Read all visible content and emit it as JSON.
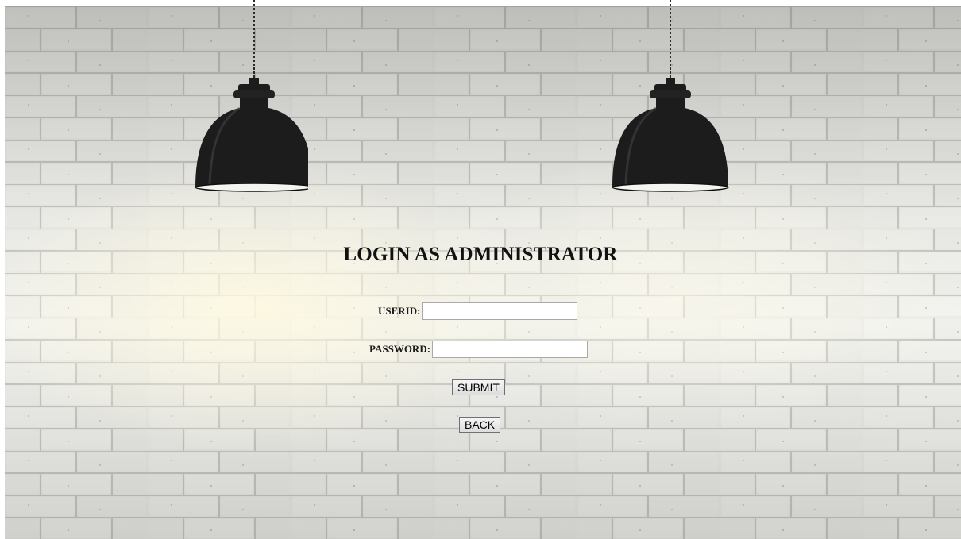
{
  "page": {
    "title": "LOGIN AS ADMINISTRATOR"
  },
  "form": {
    "userid_label": "USERID:",
    "userid_value": "",
    "password_label": "PASSWORD:",
    "password_value": "",
    "submit_label": "SUBMIT",
    "back_label": "BACK"
  },
  "colors": {
    "wall": "#e6e6e2",
    "mortar": "#cfcfca",
    "lamp": "#1c1c1c",
    "title": "#111111"
  },
  "icons": {
    "lamp": "pendant-lamp-icon"
  }
}
